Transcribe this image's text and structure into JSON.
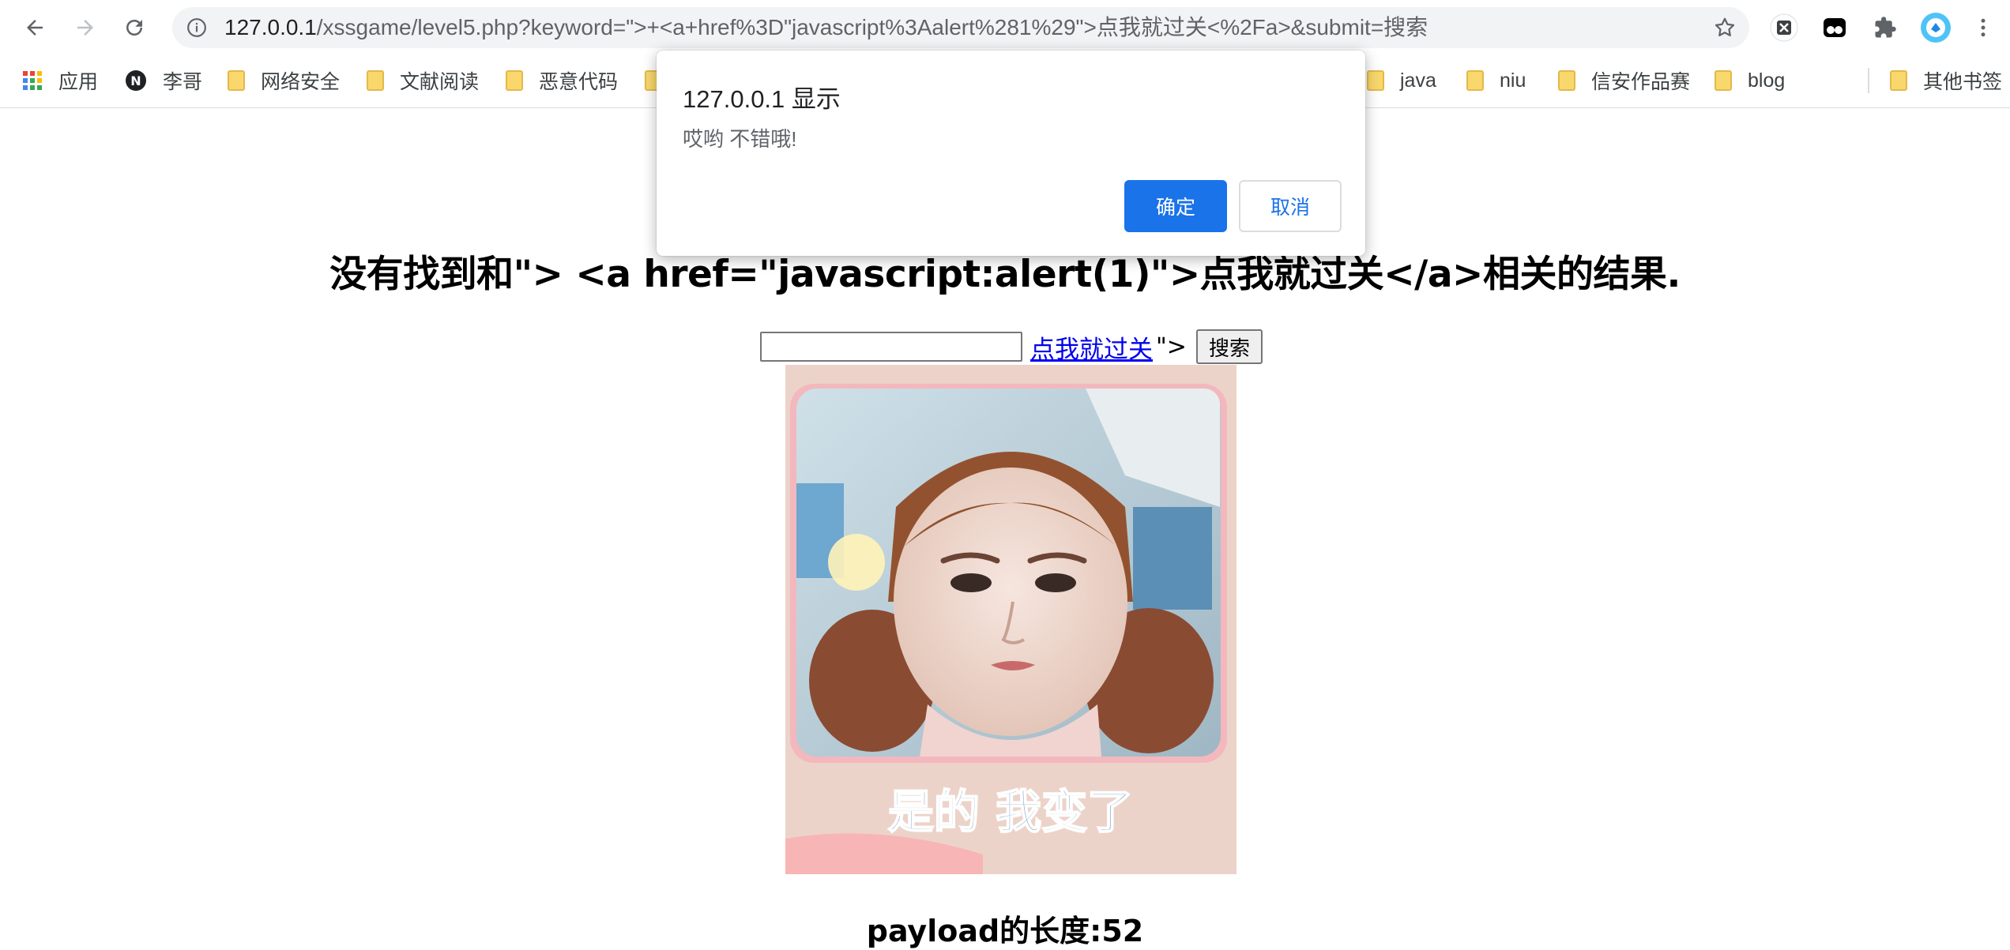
{
  "browser": {
    "url_host": "127.0.0.1",
    "url_rest": "/xssgame/level5.php?keyword=\">+<a+href%3D\"javascript%3Aalert%281%29\">点我就过关<%2Fa>&submit=搜索",
    "icons": [
      "back-icon",
      "forward-icon",
      "reload-icon",
      "info-icon",
      "star-icon",
      "extension-x-icon",
      "extension-tampermonkey-icon",
      "puzzle-icon",
      "profile-icon",
      "menu-kebab-icon"
    ]
  },
  "bookmarks": {
    "apps_label": "应用",
    "items": [
      {
        "label": "李哥",
        "icon": "notion-icon"
      },
      {
        "label": "网络安全",
        "icon": "folder-icon"
      },
      {
        "label": "文献阅读",
        "icon": "folder-icon"
      },
      {
        "label": "恶意代码",
        "icon": "folder-icon"
      },
      {
        "label": "java",
        "icon": "folder-icon"
      },
      {
        "label": "niu",
        "icon": "folder-icon"
      },
      {
        "label": "信安作品赛",
        "icon": "folder-icon"
      },
      {
        "label": "blog",
        "icon": "folder-icon"
      }
    ],
    "other_label": "其他书签"
  },
  "dialog": {
    "title": "127.0.0.1 显示",
    "message": "哎哟 不错哦!",
    "ok_label": "确定",
    "cancel_label": "取消"
  },
  "page": {
    "heading": "没有找到和\"> <a href=\"javascript:alert(1)\">点我就过关</a>相关的结果.",
    "search_value": "",
    "link_text": "点我就过关",
    "after_link": "\">",
    "search_button": "搜索",
    "image_caption": "是的 我变了",
    "payload_length": "payload的长度:52"
  }
}
